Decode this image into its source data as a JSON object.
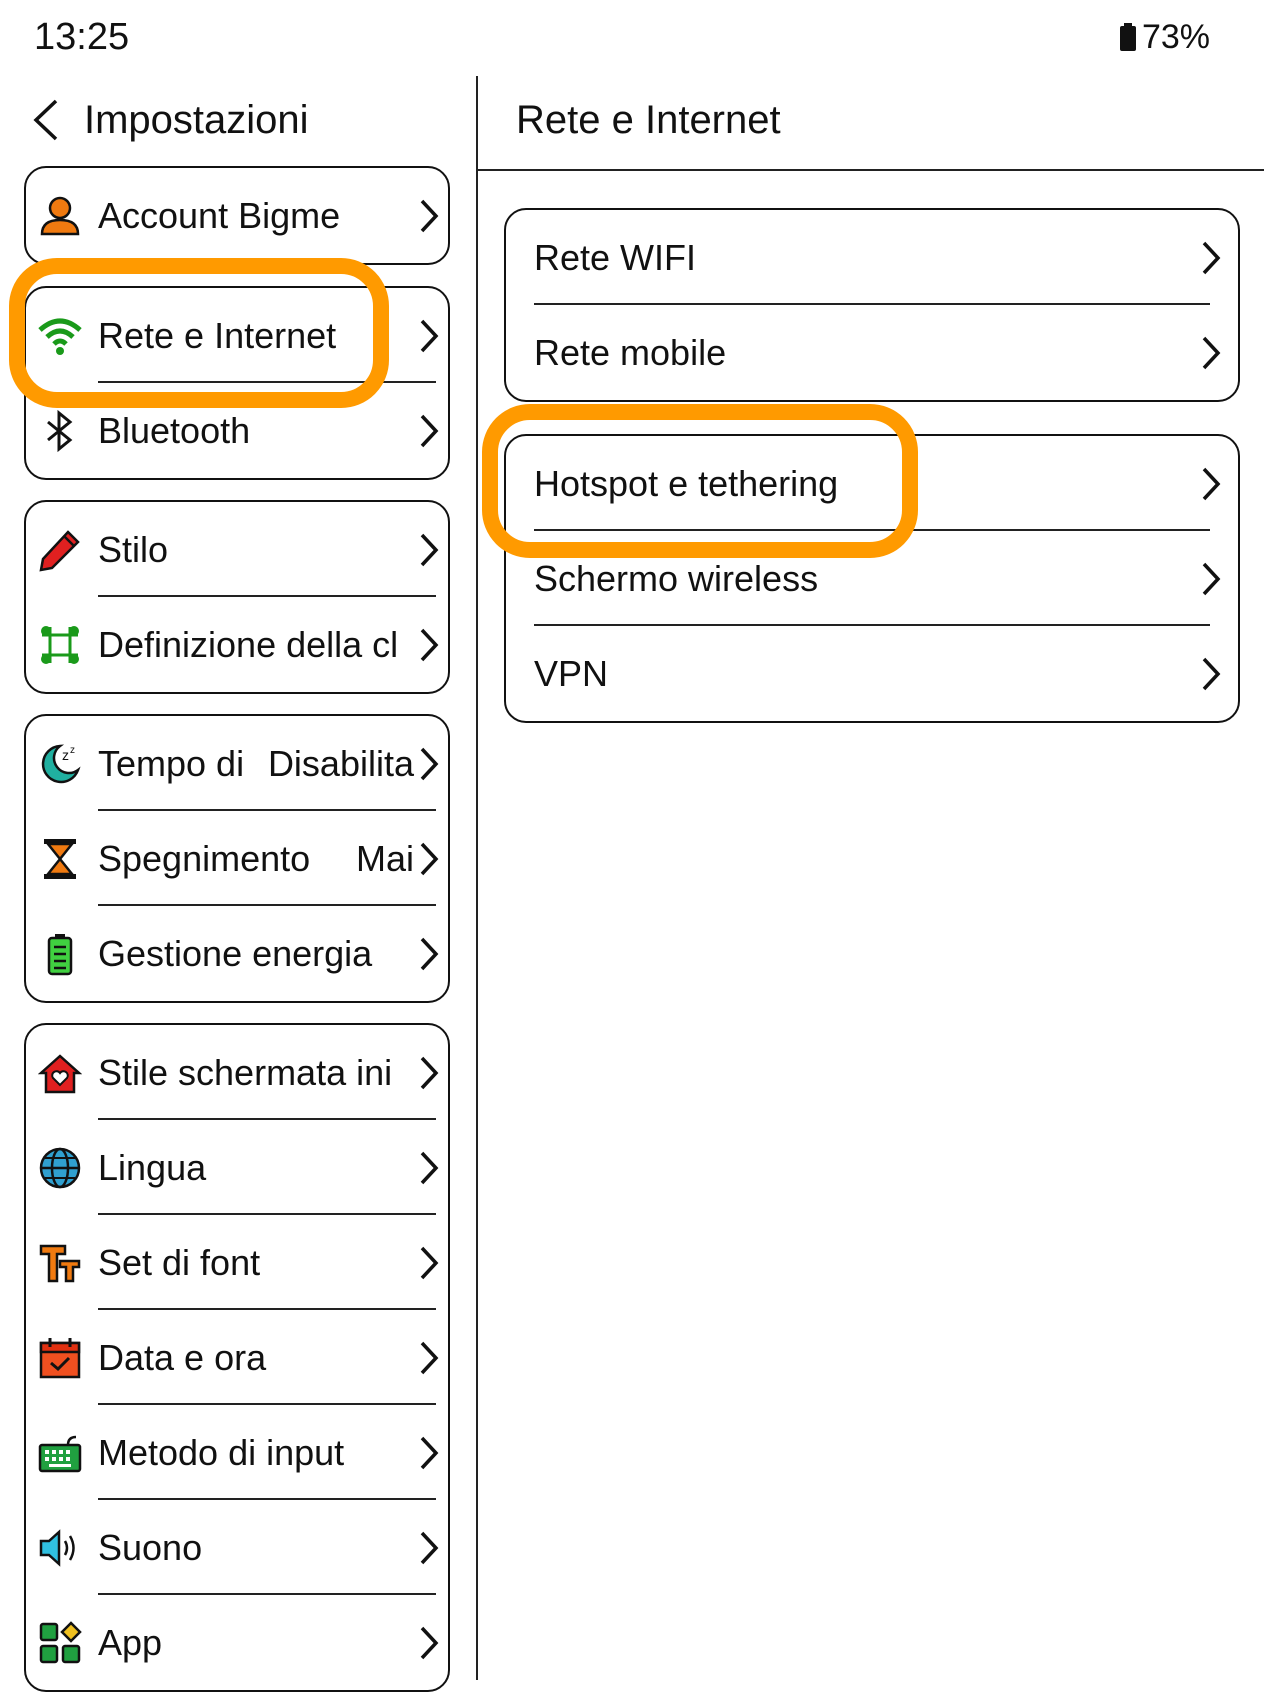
{
  "status_bar": {
    "time": "13:25",
    "battery": "73%"
  },
  "header": {
    "title": "Impostazioni"
  },
  "detail": {
    "title": "Rete e Internet"
  },
  "left_groups": [
    [
      {
        "label": "Account Bigme",
        "icon": "account-icon"
      }
    ],
    [
      {
        "label": "Rete e Internet",
        "icon": "wifi-icon"
      },
      {
        "label": "Bluetooth",
        "icon": "bluetooth-icon"
      }
    ],
    [
      {
        "label": "Stilo",
        "icon": "pen-icon"
      },
      {
        "label": "Definizione della cl",
        "icon": "shortcut-icon"
      }
    ],
    [
      {
        "label": "Tempo di",
        "value": "Disabilita",
        "icon": "sleep-icon"
      },
      {
        "label": "Spegnimento",
        "value": "Mai",
        "icon": "hourglass-icon"
      },
      {
        "label": "Gestione energia",
        "icon": "battery-icon"
      }
    ],
    [
      {
        "label": "Stile schermata ini",
        "icon": "home-icon"
      },
      {
        "label": "Lingua",
        "icon": "globe-icon"
      },
      {
        "label": "Set di font",
        "icon": "font-icon"
      },
      {
        "label": "Data e ora",
        "icon": "calendar-icon"
      },
      {
        "label": "Metodo di input",
        "icon": "keyboard-icon"
      },
      {
        "label": "Suono",
        "icon": "speaker-icon"
      },
      {
        "label": "App",
        "icon": "apps-icon"
      }
    ]
  ],
  "right_groups": [
    [
      {
        "label": "Rete WIFI"
      },
      {
        "label": "Rete mobile"
      }
    ],
    [
      {
        "label": "Hotspot e tethering"
      },
      {
        "label": "Schermo wireless"
      },
      {
        "label": "VPN"
      }
    ]
  ],
  "colors": {
    "highlight": "#ff9a00",
    "wifi": "#1a9a1a",
    "account": "#f07a10",
    "pen": "#e02020"
  }
}
